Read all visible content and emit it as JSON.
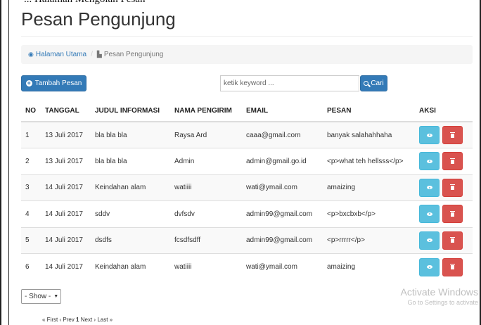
{
  "caption": "... Halaman Mengolah Pesan",
  "page": {
    "title": "Pesan Pengunjung"
  },
  "breadcrumb": {
    "home": "Halaman Utama",
    "current": "Pesan Pengunjung"
  },
  "toolbar": {
    "add_label": "Tambah Pesan",
    "search_placeholder": "ketik keyword ...",
    "search_label": "Cari"
  },
  "table": {
    "headers": {
      "no": "NO",
      "tanggal": "TANGGAL",
      "judul": "JUDUL INFORMASI",
      "pengirim": "NAMA PENGIRIM",
      "email": "EMAIL",
      "pesan": "PESAN",
      "aksi": "AKSI"
    },
    "rows": [
      {
        "no": "1",
        "tanggal": "13 Juli 2017",
        "judul": "bla bla bla",
        "pengirim": "Raysa Ard",
        "email": "caaa@gmail.com",
        "pesan": "banyak salahahhaha"
      },
      {
        "no": "2",
        "tanggal": "13 Juli 2017",
        "judul": "bla bla bla",
        "pengirim": "Admin",
        "email": "admin@gmail.go.id",
        "pesan": "<p>what teh hellsss</p>"
      },
      {
        "no": "3",
        "tanggal": "14 Juli 2017",
        "judul": "Keindahan alam",
        "pengirim": "watiiii",
        "email": "wati@ymail.com",
        "pesan": "amaizing"
      },
      {
        "no": "4",
        "tanggal": "14 Juli 2017",
        "judul": "sddv",
        "pengirim": "dvfsdv",
        "email": "admin99@gmail.com",
        "pesan": "<p>bxcbxb</p>"
      },
      {
        "no": "5",
        "tanggal": "14 Juli 2017",
        "judul": "dsdfs",
        "pengirim": "fcsdfsdff",
        "email": "admin99@gmail.com",
        "pesan": "<p>rrrrr</p>"
      },
      {
        "no": "6",
        "tanggal": "14 Juli 2017",
        "judul": "Keindahan alam",
        "pengirim": "watiiii",
        "email": "wati@ymail.com",
        "pesan": "amaizing"
      }
    ]
  },
  "show_select": {
    "value": "- Show -"
  },
  "watermark": {
    "title": "Activate Windows",
    "subtitle": "Go to Settings to activate"
  },
  "pagination": {
    "first": "« First",
    "prev": "‹ Prev",
    "current": "1",
    "next": "Next ›",
    "last": "Last »"
  },
  "colors": {
    "primary": "#337ab7",
    "info": "#5bc0de",
    "danger": "#d9534f"
  }
}
